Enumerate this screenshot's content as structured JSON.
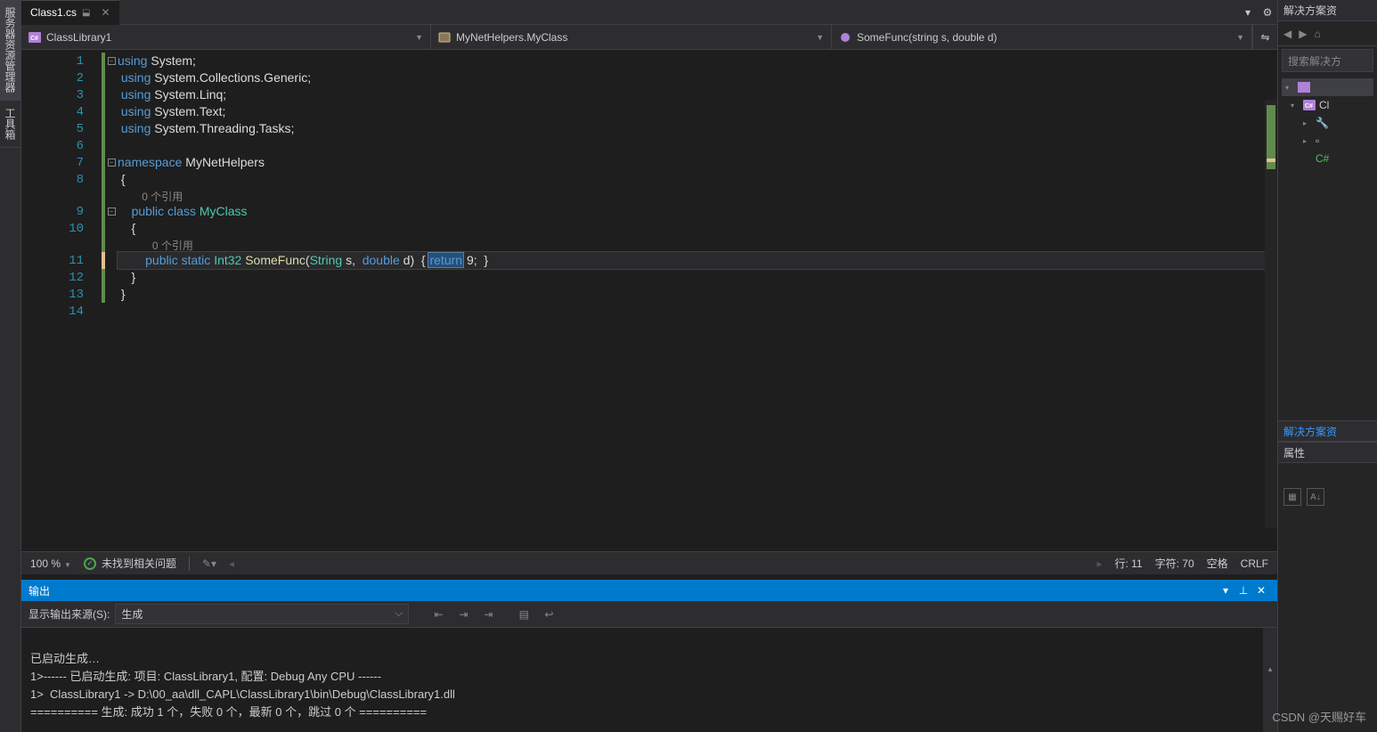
{
  "tab": {
    "filename": "Class1.cs"
  },
  "nav": {
    "project": "ClassLibrary1",
    "class": "MyNetHelpers.MyClass",
    "member": "SomeFunc(string s, double d)"
  },
  "code": {
    "refs": "0 个引用",
    "l1_kw": "using",
    "l1_ns": "System;",
    "l2_ns": "System.Collections.Generic;",
    "l3_ns": "System.Linq;",
    "l4_ns": "System.Text;",
    "l5_ns": "System.Threading.Tasks;",
    "l7_kw": "namespace",
    "l7_nm": "MyNetHelpers",
    "l9_pub": "public",
    "l9_cls": "class",
    "l9_nm": "MyClass",
    "l11_pub": "public",
    "l11_static": "static",
    "l11_type": "Int32",
    "l11_fn": "SomeFunc",
    "l11_p1t": "String",
    "l11_p1n": "s",
    "l11_p2t": "double",
    "l11_p2n": "d",
    "l11_ret": "return",
    "l11_val": "9"
  },
  "linenums": [
    "1",
    "2",
    "3",
    "4",
    "5",
    "6",
    "7",
    "8",
    "9",
    "10",
    "11",
    "12",
    "13",
    "14"
  ],
  "status": {
    "zoom": "100 %",
    "issues": "未找到相关问题",
    "line": "行: 11",
    "char": "字符: 70",
    "ins": "空格",
    "eol": "CRLF"
  },
  "output": {
    "title": "输出",
    "source_label": "显示输出来源(S):",
    "source_value": "生成",
    "lines": [
      "已启动生成…",
      "1>------ 已启动生成: 项目: ClassLibrary1, 配置: Debug Any CPU ------",
      "1>  ClassLibrary1 -> D:\\00_aa\\dll_CAPL\\ClassLibrary1\\bin\\Debug\\ClassLibrary1.dll",
      "========== 生成: 成功 1 个，失败 0 个，最新 0 个，跳过 0 个 =========="
    ]
  },
  "right": {
    "title": "解决方案资",
    "search": "搜索解决方",
    "sln": "Cl",
    "section": "解决方案资",
    "prop": "属性"
  },
  "left_tabs": [
    "服务器资源管理器",
    "工具箱"
  ],
  "watermark": "CSDN @天赐好车"
}
